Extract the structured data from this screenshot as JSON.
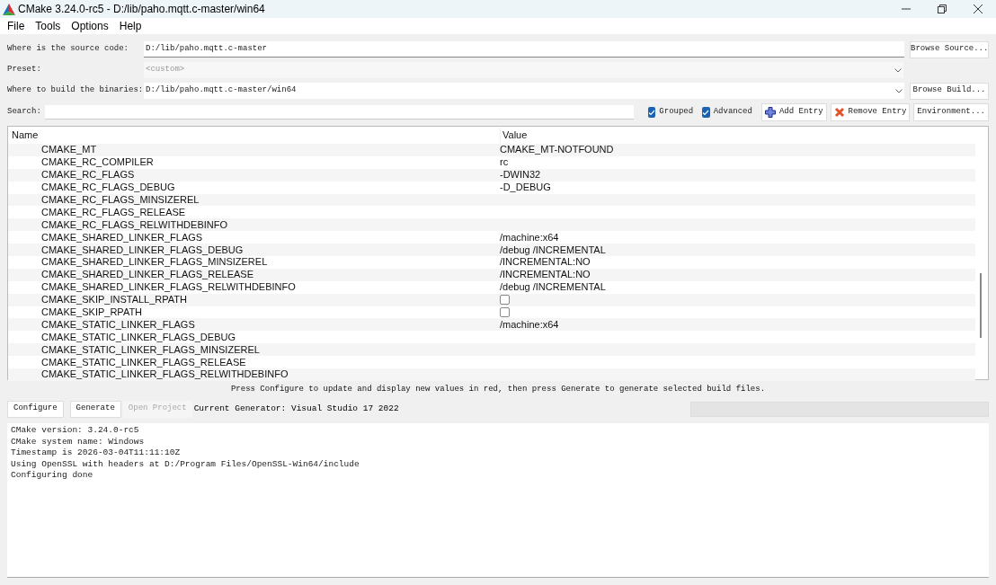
{
  "window": {
    "title": "CMake 3.24.0-rc5 - D:/lib/paho.mqtt.c-master/win64"
  },
  "menu": [
    "File",
    "Tools",
    "Options",
    "Help"
  ],
  "source": {
    "label": "Where is the source code:",
    "value": "D:/lib/paho.mqtt.c-master",
    "button": "Browse Source..."
  },
  "preset": {
    "label": "Preset:",
    "value": "<custom>",
    "disabled": true
  },
  "build": {
    "label": "Where to build the binaries:",
    "value": "D:/lib/paho.mqtt.c-master/win64",
    "button": "Browse Build..."
  },
  "search": {
    "label": "Search:"
  },
  "toggles": [
    {
      "label": "Grouped",
      "checked": true
    },
    {
      "label": "Advanced",
      "checked": true
    }
  ],
  "toolbar_buttons": [
    {
      "kind": "add",
      "label": "Add Entry"
    },
    {
      "kind": "remove",
      "label": "Remove Entry"
    },
    {
      "kind": "plain",
      "label": "Environment..."
    }
  ],
  "table": {
    "columns": [
      "Name",
      "Value"
    ],
    "rows": [
      {
        "name": "CMAKE_MT",
        "kind": "text",
        "value": "CMAKE_MT-NOTFOUND"
      },
      {
        "name": "CMAKE_RC_COMPILER",
        "kind": "text",
        "value": "rc"
      },
      {
        "name": "CMAKE_RC_FLAGS",
        "kind": "text",
        "value": "-DWIN32"
      },
      {
        "name": "CMAKE_RC_FLAGS_DEBUG",
        "kind": "text",
        "value": "-D_DEBUG"
      },
      {
        "name": "CMAKE_RC_FLAGS_MINSIZEREL",
        "kind": "empty"
      },
      {
        "name": "CMAKE_RC_FLAGS_RELEASE",
        "kind": "empty"
      },
      {
        "name": "CMAKE_RC_FLAGS_RELWITHDEBINFO",
        "kind": "empty"
      },
      {
        "name": "CMAKE_SHARED_LINKER_FLAGS",
        "kind": "text",
        "value": "/machine:x64"
      },
      {
        "name": "CMAKE_SHARED_LINKER_FLAGS_DEBUG",
        "kind": "text",
        "value": "/debug /INCREMENTAL"
      },
      {
        "name": "CMAKE_SHARED_LINKER_FLAGS_MINSIZEREL",
        "kind": "text",
        "value": "/INCREMENTAL:NO"
      },
      {
        "name": "CMAKE_SHARED_LINKER_FLAGS_RELEASE",
        "kind": "text",
        "value": "/INCREMENTAL:NO"
      },
      {
        "name": "CMAKE_SHARED_LINKER_FLAGS_RELWITHDEBINFO",
        "kind": "text",
        "value": "/debug /INCREMENTAL"
      },
      {
        "name": "CMAKE_SKIP_INSTALL_RPATH",
        "kind": "checkbox",
        "checked": false
      },
      {
        "name": "CMAKE_SKIP_RPATH",
        "kind": "checkbox",
        "checked": false
      },
      {
        "name": "CMAKE_STATIC_LINKER_FLAGS",
        "kind": "text",
        "value": "/machine:x64"
      },
      {
        "name": "CMAKE_STATIC_LINKER_FLAGS_DEBUG",
        "kind": "empty"
      },
      {
        "name": "CMAKE_STATIC_LINKER_FLAGS_MINSIZEREL",
        "kind": "empty"
      },
      {
        "name": "CMAKE_STATIC_LINKER_FLAGS_RELEASE",
        "kind": "empty"
      },
      {
        "name": "CMAKE_STATIC_LINKER_FLAGS_RELWITHDEBINFO",
        "kind": "empty"
      }
    ]
  },
  "hint": "Press Configure to update and display new values in red, then press Generate to generate selected build files.",
  "actions": [
    {
      "label": "Configure",
      "disabled": false
    },
    {
      "label": "Generate",
      "disabled": false
    },
    {
      "label": "Open Project",
      "disabled": true
    }
  ],
  "generator": "Current Generator: Visual Studio 17 2022",
  "progress": {
    "level": 0
  },
  "log": [
    "CMake version: 3.24.0-rc5",
    "CMake system name: Windows",
    "Timestamp is 2026-03-04T11:11:10Z",
    "Using OpenSSL with headers at D:/Program Files/OpenSSL-Win64/include",
    "Configuring done"
  ]
}
